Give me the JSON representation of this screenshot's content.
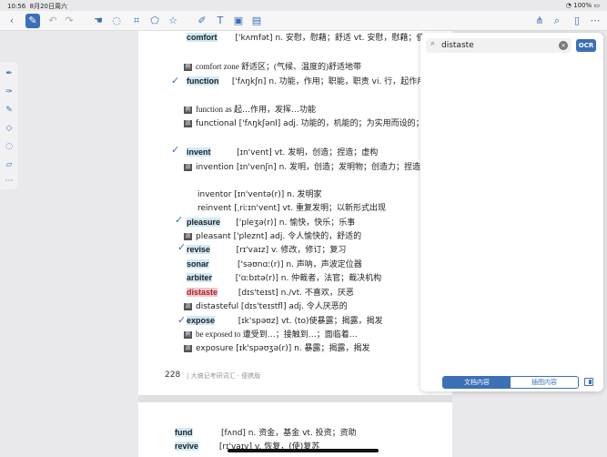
{
  "status": {
    "time": "10:56",
    "date": "8月20日周六",
    "battery": "100%"
  },
  "entries": [
    {
      "word": "comfort",
      "phon": "['kʌmfət]",
      "def": "n. 安慰，慰藉；舒适 vt. 安慰，慰藉；使舒适"
    },
    {
      "word": "",
      "phon": "",
      "def": "comfort zone 舒适区；(气候、温度的)舒适地带"
    },
    {
      "word": "function",
      "phon": "['fʌŋkʃn]",
      "def": "n. 功能，作用；职能，职责 vi. 行，起作用"
    },
    {
      "word": "",
      "phon": "",
      "def": "function as 起…作用，发挥…功能"
    },
    {
      "word": "",
      "phon": "",
      "def": "functional ['fʌŋkʃənl] adj. 功能的，机能的；为实用而设的；具备功能的"
    },
    {
      "word": "invent",
      "phon": "[ɪn'vent]",
      "def": "vt. 发明，创造；捏造；虚构"
    },
    {
      "word": "",
      "phon": "",
      "def": "invention [ɪn'venʃn] n. 发明，创造；发明物；创造力；捏造，虚构"
    },
    {
      "word": "",
      "phon": "",
      "def": "inventor [ɪn'ventə(r)] n. 发明家"
    },
    {
      "word": "",
      "phon": "",
      "def": "reinvent [ˌriːɪn'vent] vt. 重复发明；以新形式出现"
    },
    {
      "word": "pleasure",
      "phon": "['pleʒə(r)]",
      "def": "n. 愉快，快乐；乐事"
    },
    {
      "word": "",
      "phon": "",
      "def": "pleasant ['pleznt] adj. 令人愉快的，舒适的"
    },
    {
      "word": "revise",
      "phon": "[rɪ'vaɪz]",
      "def": "v. 修改，修订；复习"
    },
    {
      "word": "sonar",
      "phon": "['səʊnɑː(r)]",
      "def": "n. 声呐，声波定位器"
    },
    {
      "word": "arbiter",
      "phon": "['ɑːbɪtə(r)]",
      "def": "n. 仲裁者，法官；裁决机构"
    },
    {
      "word": "distaste",
      "phon": "[dɪs'teɪst]",
      "def": "n./vt. 不喜欢，厌恶"
    },
    {
      "word": "",
      "phon": "",
      "def": "distasteful [dɪs'teɪstfl] adj. 令人厌恶的"
    },
    {
      "word": "expose",
      "phon": "[ɪk'spəʊz]",
      "def": "vt. (to)使暴露；揭露，揭发"
    },
    {
      "word": "",
      "phon": "",
      "def": "be exposed to 遭受到…；接触到…；面临着…"
    },
    {
      "word": "",
      "phon": "",
      "def": "exposure [ɪk'spəʊʒə(r)] n. 暴露；揭露，揭发"
    }
  ],
  "page": {
    "number": "228",
    "footer": "| 大搞记考研词汇 · 便携版"
  },
  "page2": [
    {
      "word": "fund",
      "phon": "[fʌnd]",
      "def": "n. 资金，基金 vt. 投资；资助"
    },
    {
      "word": "revive",
      "phon": "[rɪ'vaɪv]",
      "def": "v. 恢复，(使)复苏"
    }
  ],
  "search": {
    "query": "distaste",
    "ocr": "OCR",
    "tab_doc": "文档内容",
    "tab_note": "插图内容"
  }
}
